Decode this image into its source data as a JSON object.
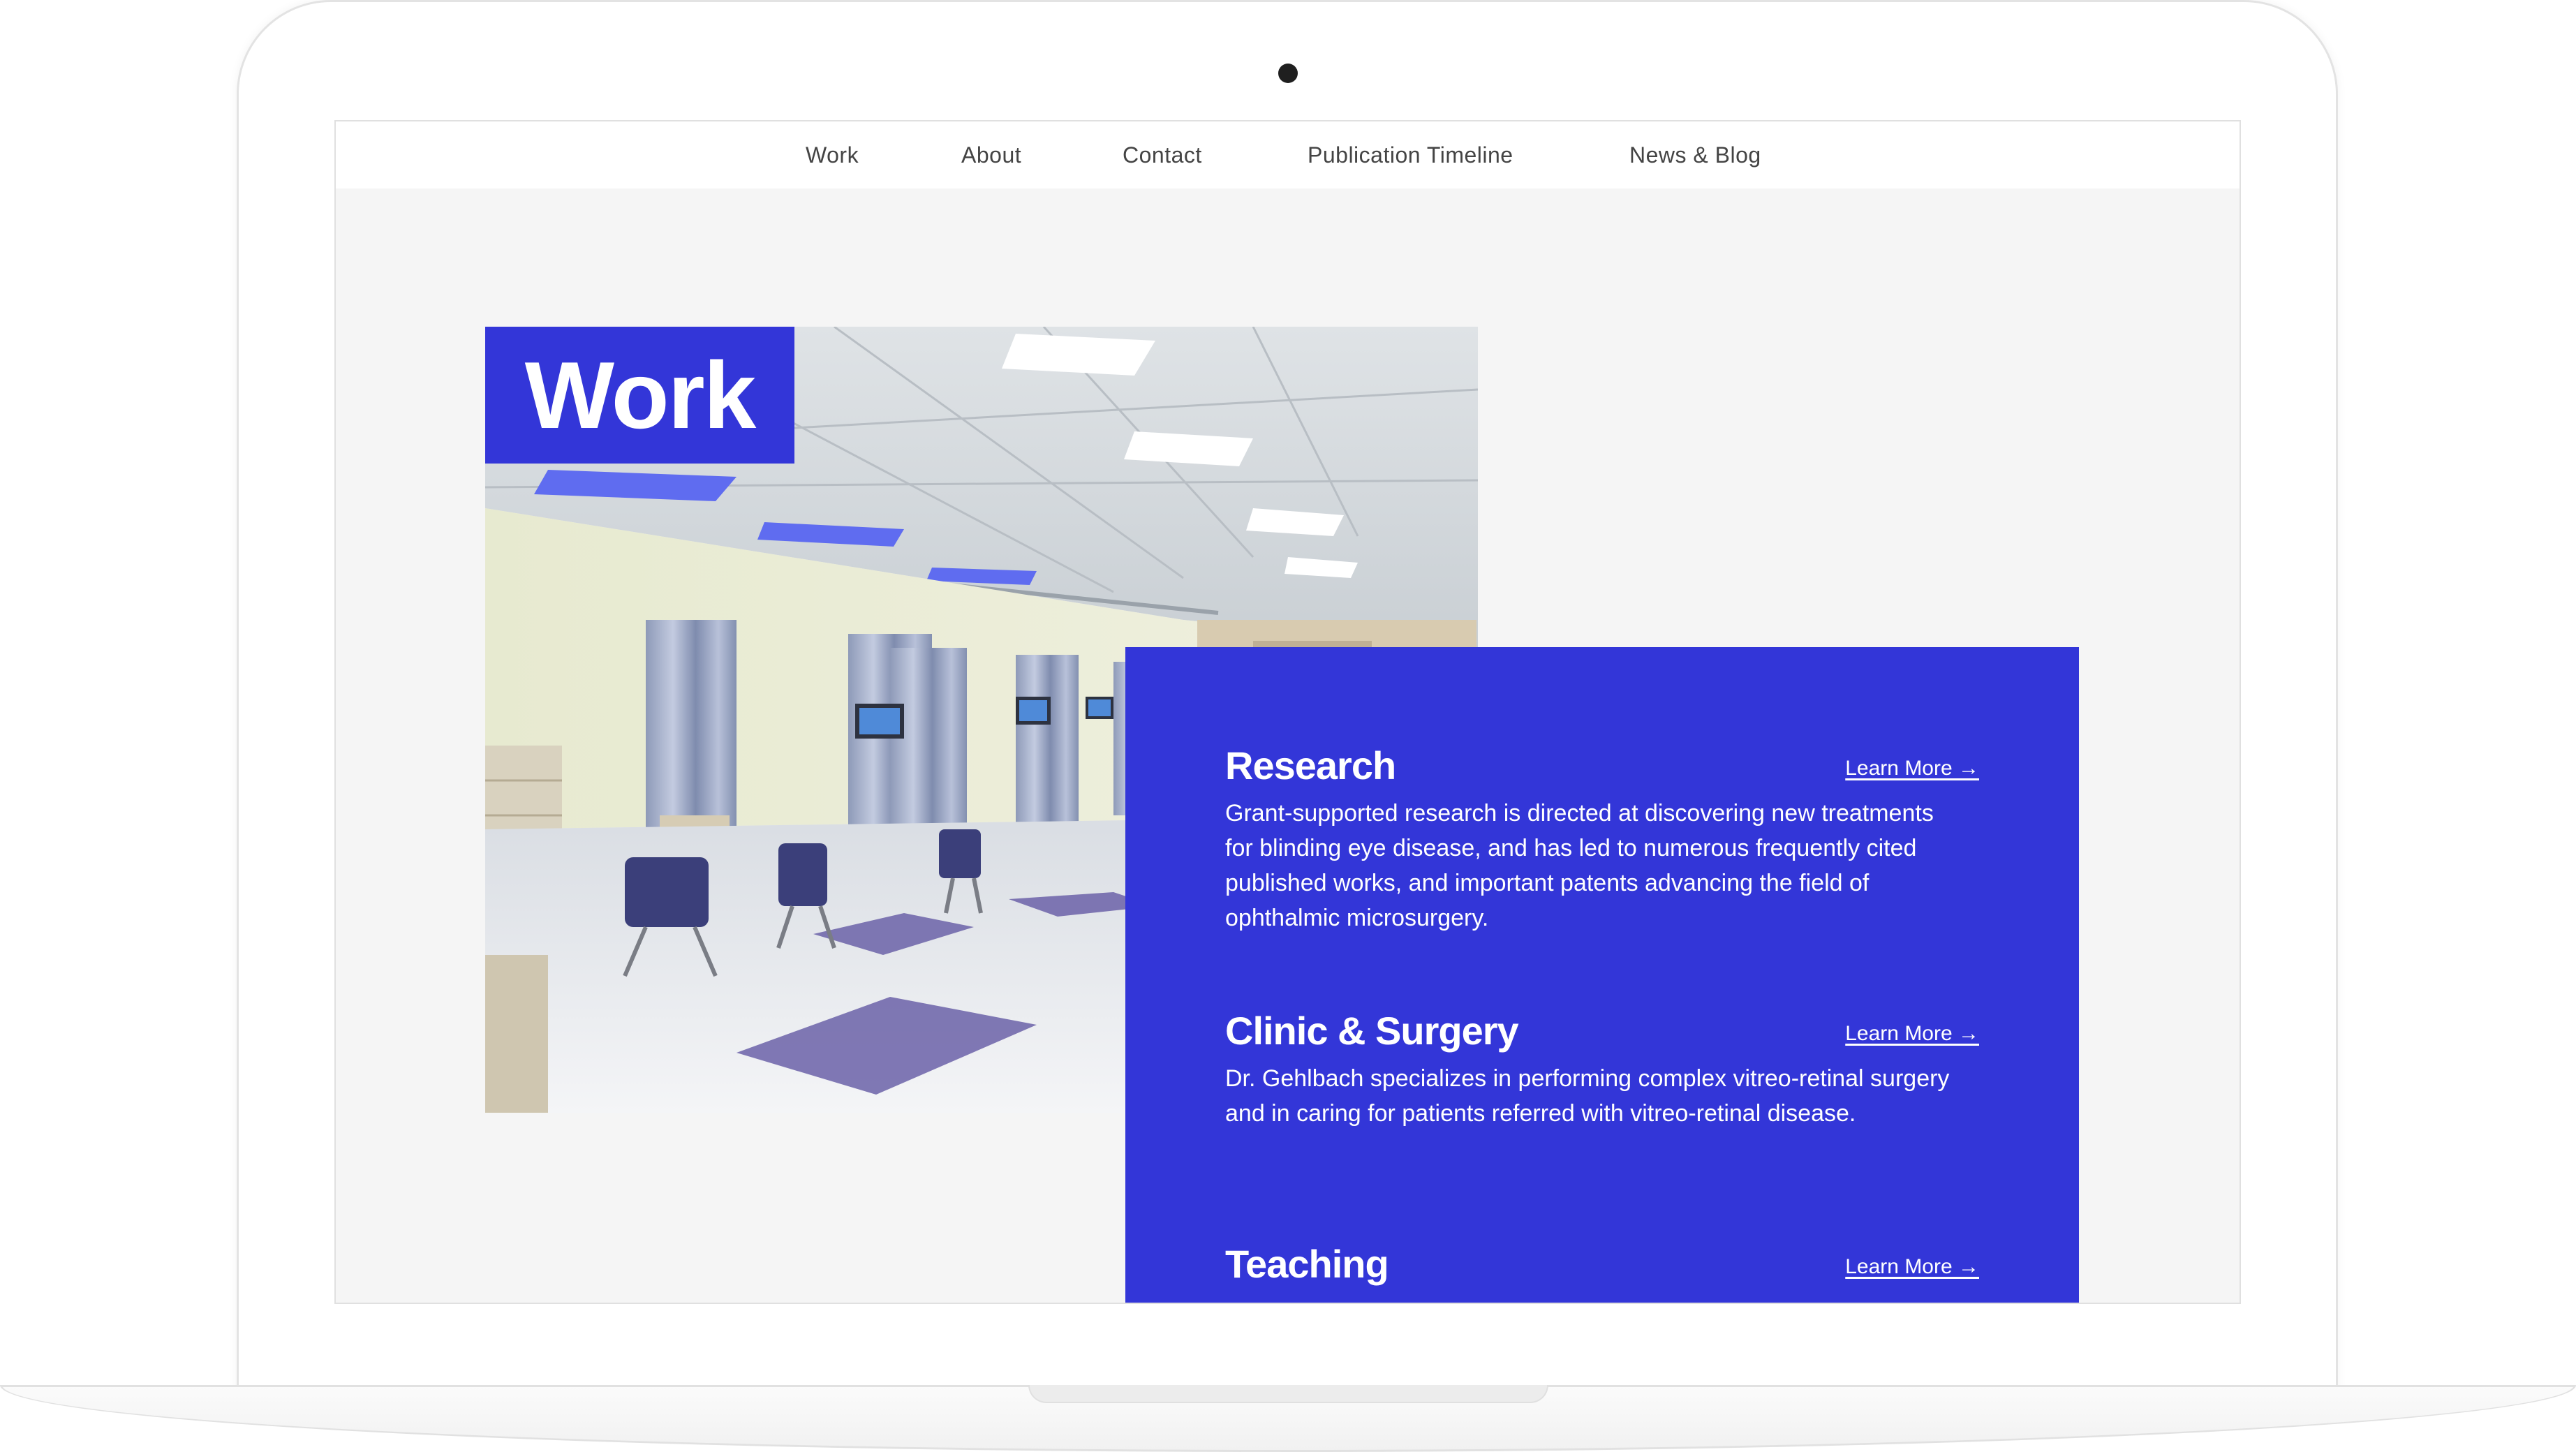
{
  "nav": {
    "items": [
      {
        "label": "Work"
      },
      {
        "label": "About"
      },
      {
        "label": "Contact"
      },
      {
        "label": "Publication Timeline"
      },
      {
        "label": "News & Blog"
      }
    ]
  },
  "hero": {
    "title": "Work"
  },
  "sections": [
    {
      "title": "Research",
      "link": "Learn More →",
      "description": "Grant-supported research is directed at discovering new treatments for blinding eye disease, and has led to numerous frequently cited published works, and important patents advancing the field of ophthalmic microsurgery."
    },
    {
      "title": "Clinic & Surgery",
      "link": "Learn More →",
      "description": "Dr. Gehlbach specializes in performing complex vitreo-retinal surgery and in caring for patients referred with vitreo-retinal disease."
    },
    {
      "title": "Teaching",
      "link": "Learn More →"
    }
  ],
  "colors": {
    "accent": "#3336d8",
    "page_background": "#f5f5f5",
    "nav_background": "#ffffff",
    "nav_text": "#444444"
  }
}
